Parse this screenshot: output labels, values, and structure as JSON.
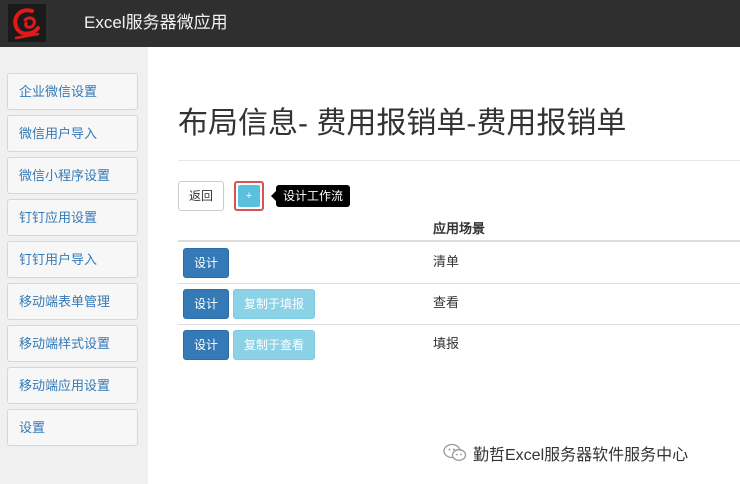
{
  "header": {
    "app_title": "Excel服务器微应用",
    "logo_icon": "brand-logo-icon"
  },
  "sidebar": {
    "items": [
      {
        "label": "企业微信设置"
      },
      {
        "label": "微信用户导入"
      },
      {
        "label": "微信小程序设置"
      },
      {
        "label": "钉钉应用设置"
      },
      {
        "label": "钉钉用户导入"
      },
      {
        "label": "移动端表单管理"
      },
      {
        "label": "移动端样式设置"
      },
      {
        "label": "移动端应用设置"
      },
      {
        "label": "设置"
      }
    ]
  },
  "main": {
    "title": "布局信息- 费用报销单-费用报销单",
    "back_label": "返回",
    "add_label": "+",
    "add_tooltip": "设计工作流",
    "column_header": "应用场景",
    "rows": [
      {
        "design_label": "设计",
        "copy_label": "",
        "scene": "清单"
      },
      {
        "design_label": "设计",
        "copy_label": "复制于填报",
        "scene": "查看"
      },
      {
        "design_label": "设计",
        "copy_label": "复制于查看",
        "scene": "填报"
      }
    ]
  },
  "watermark": {
    "text": "勤哲Excel服务器软件服务中心",
    "icon": "wechat-icon"
  },
  "colors": {
    "topbar": "#2f2f2f",
    "primary": "#337ab7",
    "info": "#5bc0de",
    "highlight": "#d9534f"
  }
}
